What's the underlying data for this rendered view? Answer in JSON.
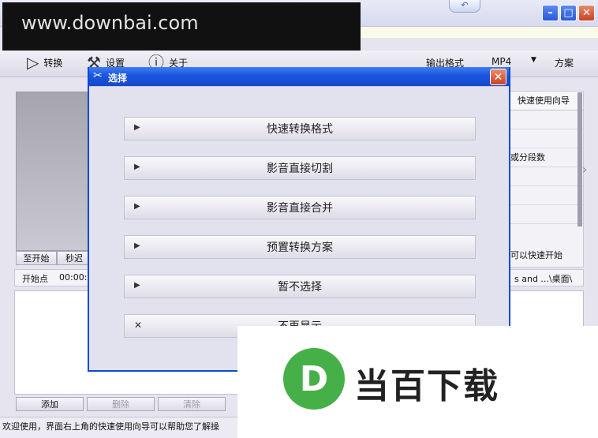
{
  "watermark": {
    "url": "www.downbai.com"
  },
  "toolbar": {
    "convert_label": "转换",
    "settings_label": "设置",
    "about_label": "关于",
    "format_label": "输出格式",
    "format_value": "MP4",
    "scheme_label": "方案"
  },
  "side_panel": {
    "wizard_label": "快速使用向导",
    "rows": [
      "或分段数",
      "可以快速开始"
    ]
  },
  "left_panel": {
    "start_btn": "至开始",
    "sec_btn": "秒迟",
    "start_point_label": "开始点",
    "start_point_value": "00:00:0",
    "path_value": "s and ...\\桌面\\ ..."
  },
  "bottom_buttons": {
    "add": "添加",
    "delete": "删除",
    "clear": "清除"
  },
  "status": "欢迎使用，界面右上角的快速使用向导可以帮助您了解操",
  "dialog": {
    "title": "选择",
    "options": [
      "快速转换格式",
      "影音直接切割",
      "影音直接合并",
      "预置转换方案",
      "暂不选择",
      "不再显示"
    ]
  },
  "logo": {
    "text": "当百下载",
    "letter": "D",
    "color": "#46b048"
  }
}
